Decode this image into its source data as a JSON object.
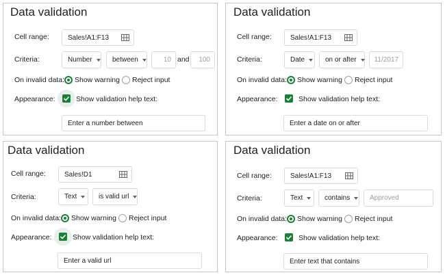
{
  "panels": [
    {
      "title": "Data validation",
      "cell_range_label": "Cell range:",
      "cell_range_value": "Sales!A1:F13",
      "criteria_label": "Criteria:",
      "criteria_type": "Number",
      "criteria_op": "between",
      "value1": "10",
      "and_label": "and",
      "value2": "100",
      "invalid_label": "On invalid data:",
      "show_warning": "Show warning",
      "reject_input": "Reject input",
      "appearance_label": "Appearance:",
      "help_checkbox": "Show validation help text:",
      "help_text": "Enter a number between"
    },
    {
      "title": "Data validation",
      "cell_range_label": "Cell range:",
      "cell_range_value": "Sales!A1:F13",
      "criteria_label": "Criteria:",
      "criteria_type": "Date",
      "criteria_op": "on or after",
      "value1": "11/2017",
      "invalid_label": "On invalid data:",
      "show_warning": "Show warning",
      "reject_input": "Reject input",
      "appearance_label": "Appearance:",
      "help_checkbox": "Show validation help text:",
      "help_text": "Enter a date on or after"
    },
    {
      "title": "Data validation",
      "cell_range_label": "Cell range:",
      "cell_range_value": "Sales!D1",
      "criteria_label": "Criteria:",
      "criteria_type": "Text",
      "criteria_op": "is valid url",
      "invalid_label": "On invalid data:",
      "show_warning": "Show warning",
      "reject_input": "Reject input",
      "appearance_label": "Appearance:",
      "help_checkbox": "Show validation help text:",
      "help_text": "Enter a valid url"
    },
    {
      "title": "Data validation",
      "cell_range_label": "Cell range:",
      "cell_range_value": "Sales!A1:F13",
      "criteria_label": "Criteria:",
      "criteria_type": "Text",
      "criteria_op": "contains",
      "value1": "Approved",
      "invalid_label": "On invalid data:",
      "show_warning": "Show warning",
      "reject_input": "Reject input",
      "appearance_label": "Appearance:",
      "help_checkbox": "Show validation help text:",
      "help_text": "Enter text that contains"
    }
  ],
  "colors": {
    "accent": "#188038",
    "border": "#dadce0",
    "panel_border": "#c6c6c6"
  },
  "icons": {
    "range": "grid-icon",
    "dropdown": "caret-down-icon",
    "checkbox": "checkmark-icon"
  }
}
